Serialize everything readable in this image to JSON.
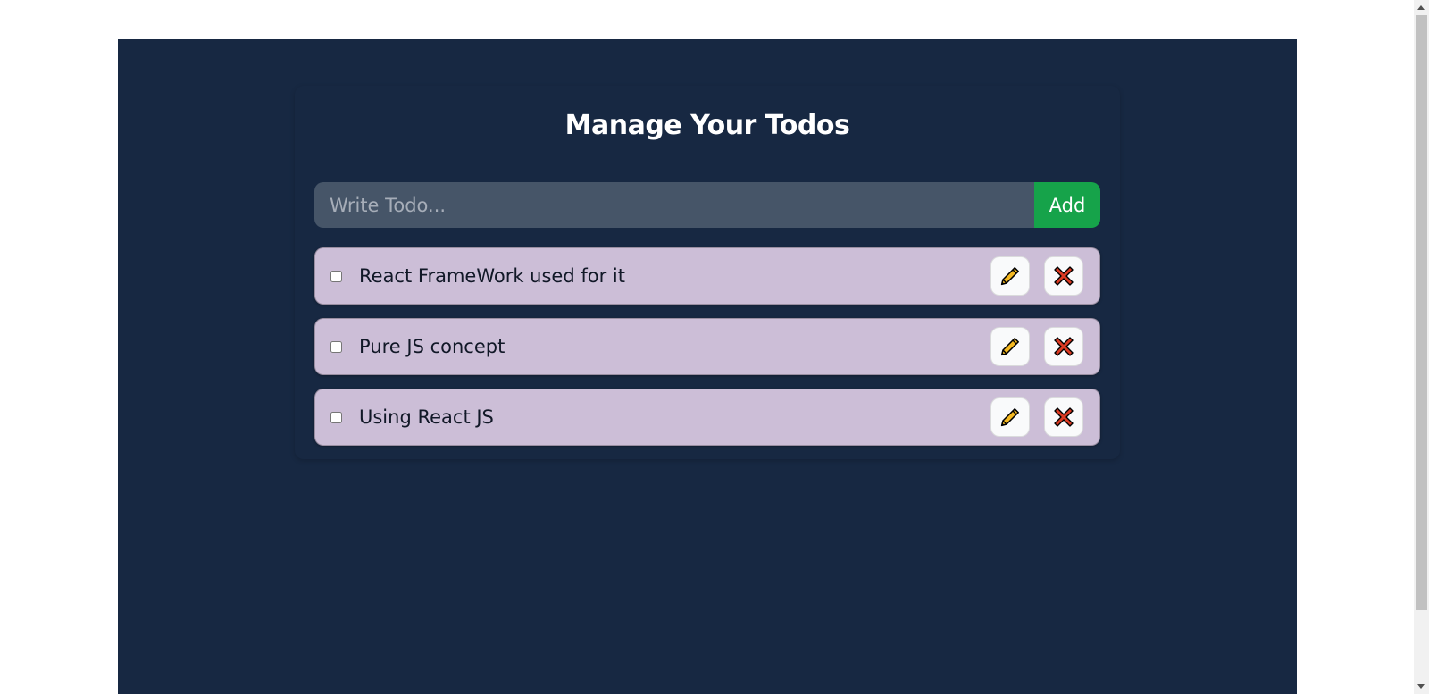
{
  "app": {
    "title": "Manage Your Todos"
  },
  "form": {
    "placeholder": "Write Todo...",
    "value": "",
    "add_label": "Add"
  },
  "todos": [
    {
      "text": "React FrameWork used for it",
      "completed": false
    },
    {
      "text": "Pure JS concept",
      "completed": false
    },
    {
      "text": "Using React JS",
      "completed": false
    }
  ],
  "icons": {
    "edit": "pencil-icon",
    "delete": "cross-mark-icon"
  },
  "colors": {
    "page_background": "#172842",
    "card_background": "#172842",
    "input_background": "#465568",
    "add_button": "#16a34a",
    "todo_item": "#ccbed7",
    "pencil": "#f5b921",
    "cross": "#dd3a22"
  }
}
